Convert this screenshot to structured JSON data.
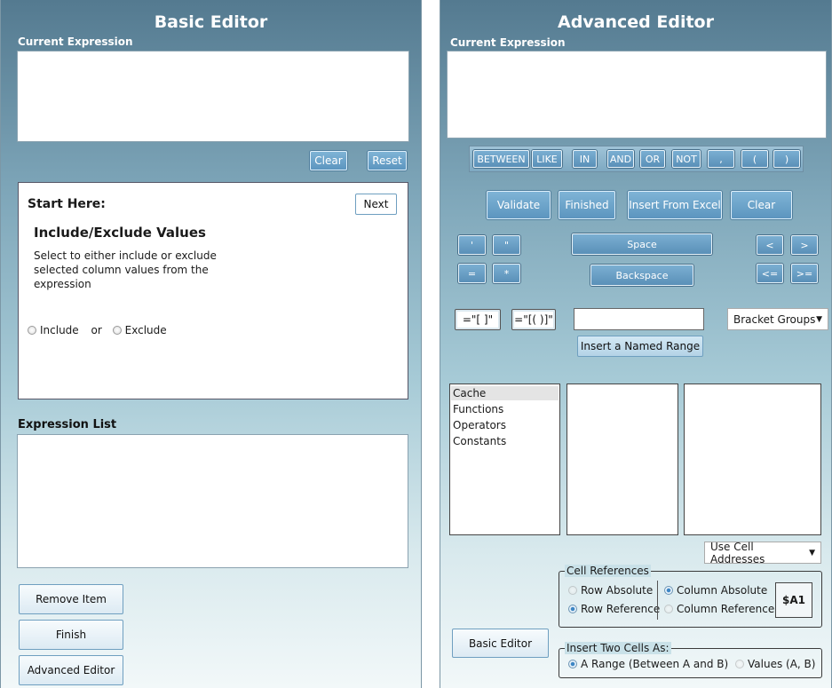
{
  "basic": {
    "title": "Basic Editor",
    "current_expression_label": "Current Expression",
    "clear": "Clear",
    "reset": "Reset",
    "start_here": "Start Here:",
    "next": "Next",
    "step_title": "Include/Exclude Values",
    "step_desc_1": "Select to either include or exclude",
    "step_desc_2": "selected column values from the",
    "step_desc_3": "expression",
    "include": "Include",
    "or": "or",
    "exclude": "Exclude",
    "expression_list_label": "Expression List",
    "remove_item": "Remove Item",
    "finish": "Finish",
    "advanced_editor": "Advanced Editor"
  },
  "advanced": {
    "title": "Advanced Editor",
    "current_expression_label": "Current Expression",
    "operators": [
      "BETWEEN",
      "LIKE",
      "IN",
      "AND",
      "OR",
      "NOT",
      ",",
      "(",
      ")"
    ],
    "validate": "Validate",
    "finished": "Finished",
    "insert_from_excel": "Insert From Excel",
    "clear": "Clear",
    "quote_single": "'",
    "quote_double": "\"",
    "equals": "=",
    "asterisk": "*",
    "space": "Space",
    "backspace": "Backspace",
    "lt": "<",
    "gt": ">",
    "le": "<=",
    "ge": ">=",
    "bracket_1": "=\"[ ]\"",
    "bracket_2": "=\"[( )]\"",
    "named_range_value": "",
    "bracket_groups": "Bracket Groups",
    "insert_named_range": "Insert a Named Range",
    "categories": [
      "Cache",
      "Functions",
      "Operators",
      "Constants"
    ],
    "use_cell_addresses": "Use Cell Addresses",
    "cell_references_legend": "Cell References",
    "row_absolute": "Row Absolute",
    "column_absolute": "Column Absolute",
    "row_reference": "Row Reference",
    "column_reference": "Column Reference",
    "cell_example": "$A1",
    "basic_editor": "Basic Editor",
    "insert_two_cells_legend": "Insert Two Cells As:",
    "a_range": "A Range (Between A and B)",
    "values": "Values (A, B)"
  }
}
